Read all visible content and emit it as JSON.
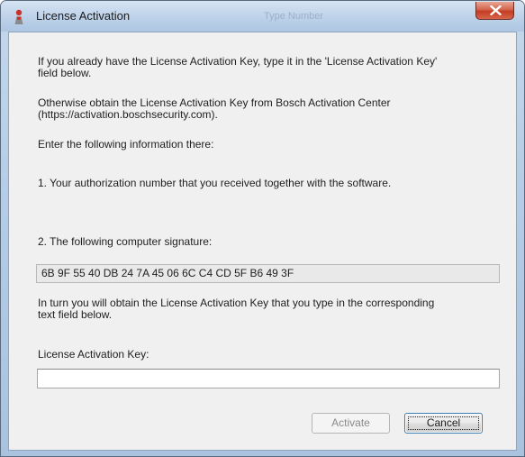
{
  "window": {
    "title": "License Activation",
    "background_title_hint_1": "Type Number",
    "close_symbol": "X"
  },
  "content": {
    "intro_line1": "If you already have the License Activation Key, type it in the 'License Activation Key'",
    "intro_line2": "field below.",
    "otherwise_line1": "Otherwise obtain the License Activation Key from Bosch Activation Center",
    "otherwise_line2": "(https://activation.boschsecurity.com).",
    "enter_info": "Enter the following information there:",
    "step1": "1. Your authorization number that you received together with the software.",
    "step2": "2. The following computer signature:",
    "signature": "6B 9F 55 40 DB 24 7A 45 06 6C C4 CD 5F B6 49 3F",
    "in_turn_line1": "In turn you will obtain the License Activation Key that you type in the corresponding",
    "in_turn_line2": "text field below.",
    "key_label": "License Activation Key:",
    "key_value": "",
    "key_placeholder": ""
  },
  "buttons": {
    "activate": "Activate",
    "cancel": "Cancel"
  },
  "colors": {
    "titlebar": "#bfd3ea",
    "close_button": "#c43c22",
    "client_background": "#f0f0f0",
    "focus_border": "#3c7fb1"
  },
  "icons": {
    "app": "bosch-person-icon",
    "close": "close-x-icon"
  }
}
